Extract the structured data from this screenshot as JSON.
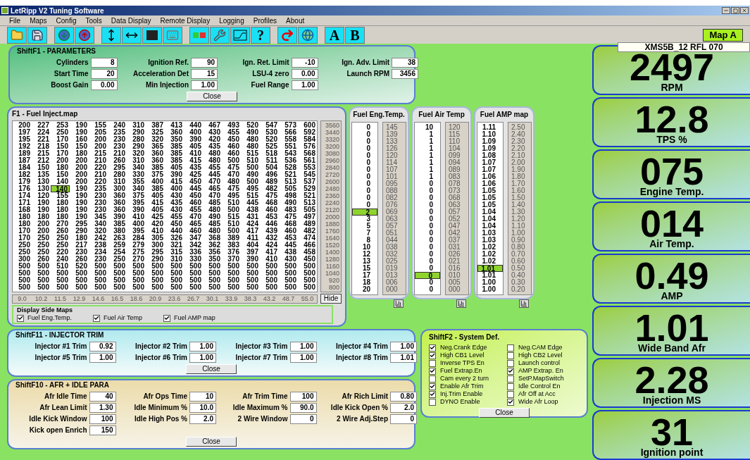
{
  "window": {
    "title": "LetRipp V2 Tuning Software"
  },
  "menu": [
    "File",
    "Maps",
    "Config",
    "Tools",
    "Data Display",
    "Remote Display",
    "Logging",
    "Profiles",
    "About"
  ],
  "toolbar": [
    [
      {
        "kind": "open"
      },
      {
        "kind": "save"
      }
    ],
    [
      {
        "kind": "download"
      },
      {
        "kind": "upload"
      }
    ],
    [
      {
        "kind": "vertical"
      },
      {
        "kind": "horizontal"
      },
      {
        "kind": "block"
      },
      {
        "kind": "key"
      }
    ],
    [
      {
        "kind": "colors"
      },
      {
        "kind": "tools"
      },
      {
        "kind": "graph"
      },
      {
        "kind": "letter",
        "label": "?"
      }
    ],
    [
      {
        "kind": "redo"
      },
      {
        "kind": "globe"
      }
    ],
    [
      {
        "kind": "letter",
        "label": "A"
      },
      {
        "kind": "letter",
        "label": "B"
      }
    ]
  ],
  "map_badge": "Map A",
  "map_name": "XMS5B_12 RFL 070",
  "parameters": {
    "title": "ShiftF1 - PARAMETERS",
    "rows": [
      [
        {
          "label": "Cylinders",
          "value": "8"
        },
        {
          "label": "Ignition Ref.",
          "value": "90"
        },
        {
          "label": "Ign. Ret. Limit",
          "value": "-10"
        },
        {
          "label": "Ign. Adv. Limit",
          "value": "38"
        }
      ],
      [
        {
          "label": "Start Time",
          "value": "20"
        },
        {
          "label": "Acceleration Det",
          "value": "15"
        },
        {
          "label": "LSU-4 zero",
          "value": "0.00"
        },
        {
          "label": "Launch RPM",
          "value": "3456"
        }
      ],
      [
        {
          "label": "Boost Gain",
          "value": "0.00"
        },
        {
          "label": "Min Injection",
          "value": "1.00"
        },
        {
          "label": "Fuel Range",
          "value": "1.00"
        }
      ]
    ],
    "close": "Close"
  },
  "fuel_map": {
    "title": "F1 - Fuel Inject.map",
    "rows": [
      {
        "rpm": "3560",
        "cells": [
          "200",
          "227",
          "253",
          "190",
          "155",
          "240",
          "310",
          "387",
          "413",
          "440",
          "467",
          "493",
          "520",
          "547",
          "573",
          "600"
        ]
      },
      {
        "rpm": "3440",
        "cells": [
          "197",
          "224",
          "250",
          "190",
          "205",
          "235",
          "290",
          "325",
          "360",
          "400",
          "430",
          "455",
          "490",
          "530",
          "566",
          "592"
        ]
      },
      {
        "rpm": "3320",
        "cells": [
          "195",
          "221",
          "170",
          "160",
          "200",
          "230",
          "280",
          "320",
          "350",
          "390",
          "420",
          "450",
          "480",
          "520",
          "558",
          "584"
        ]
      },
      {
        "rpm": "3200",
        "cells": [
          "192",
          "218",
          "150",
          "150",
          "200",
          "230",
          "290",
          "365",
          "385",
          "405",
          "435",
          "460",
          "480",
          "525",
          "551",
          "576"
        ]
      },
      {
        "rpm": "3080",
        "cells": [
          "189",
          "215",
          "170",
          "180",
          "215",
          "210",
          "320",
          "360",
          "385",
          "410",
          "480",
          "460",
          "515",
          "518",
          "543",
          "568"
        ]
      },
      {
        "rpm": "2960",
        "cells": [
          "187",
          "212",
          "200",
          "200",
          "210",
          "260",
          "310",
          "360",
          "385",
          "415",
          "480",
          "500",
          "510",
          "511",
          "536",
          "561"
        ]
      },
      {
        "rpm": "2840",
        "cells": [
          "184",
          "150",
          "180",
          "200",
          "220",
          "295",
          "340",
          "385",
          "405",
          "435",
          "455",
          "475",
          "500",
          "504",
          "528",
          "553"
        ]
      },
      {
        "rpm": "2720",
        "cells": [
          "182",
          "135",
          "150",
          "200",
          "210",
          "280",
          "330",
          "375",
          "390",
          "425",
          "445",
          "470",
          "490",
          "496",
          "521",
          "545"
        ]
      },
      {
        "rpm": "2600",
        "cells": [
          "179",
          "130",
          "140",
          "200",
          "220",
          "310",
          "355",
          "400",
          "415",
          "450",
          "470",
          "480",
          "500",
          "489",
          "513",
          "537"
        ]
      },
      {
        "rpm": "2480",
        "cells": [
          "176",
          "130",
          "140",
          "190",
          "235",
          "300",
          "340",
          "385",
          "400",
          "445",
          "465",
          "475",
          "495",
          "482",
          "505",
          "529"
        ],
        "selected": [
          false,
          false,
          true,
          false,
          false,
          false,
          false,
          false,
          false,
          false,
          false,
          false,
          false,
          false,
          false,
          false
        ]
      },
      {
        "rpm": "2360",
        "cells": [
          "174",
          "120",
          "155",
          "190",
          "230",
          "360",
          "375",
          "405",
          "430",
          "450",
          "470",
          "495",
          "515",
          "475",
          "498",
          "521"
        ]
      },
      {
        "rpm": "2240",
        "cells": [
          "171",
          "190",
          "180",
          "190",
          "230",
          "360",
          "395",
          "415",
          "435",
          "460",
          "485",
          "510",
          "445",
          "468",
          "490",
          "513"
        ]
      },
      {
        "rpm": "2120",
        "cells": [
          "168",
          "190",
          "180",
          "190",
          "230",
          "360",
          "390",
          "405",
          "430",
          "455",
          "480",
          "500",
          "438",
          "460",
          "483",
          "505"
        ]
      },
      {
        "rpm": "2000",
        "cells": [
          "180",
          "180",
          "180",
          "190",
          "345",
          "390",
          "410",
          "425",
          "455",
          "470",
          "490",
          "515",
          "431",
          "453",
          "475",
          "497"
        ]
      },
      {
        "rpm": "1880",
        "cells": [
          "180",
          "200",
          "270",
          "295",
          "340",
          "385",
          "400",
          "420",
          "450",
          "465",
          "485",
          "510",
          "424",
          "446",
          "468",
          "489"
        ]
      },
      {
        "rpm": "1760",
        "cells": [
          "170",
          "200",
          "260",
          "290",
          "320",
          "380",
          "395",
          "410",
          "440",
          "460",
          "480",
          "500",
          "417",
          "439",
          "460",
          "482"
        ]
      },
      {
        "rpm": "1640",
        "cells": [
          "170",
          "250",
          "250",
          "180",
          "242",
          "263",
          "284",
          "305",
          "326",
          "347",
          "368",
          "389",
          "411",
          "432",
          "453",
          "474"
        ]
      },
      {
        "rpm": "1520",
        "cells": [
          "250",
          "250",
          "250",
          "217",
          "238",
          "259",
          "279",
          "300",
          "321",
          "342",
          "362",
          "383",
          "404",
          "424",
          "445",
          "466"
        ]
      },
      {
        "rpm": "1400",
        "cells": [
          "250",
          "250",
          "220",
          "230",
          "234",
          "254",
          "275",
          "295",
          "315",
          "336",
          "356",
          "376",
          "397",
          "417",
          "438",
          "458"
        ]
      },
      {
        "rpm": "1280",
        "cells": [
          "300",
          "260",
          "240",
          "260",
          "230",
          "250",
          "270",
          "290",
          "310",
          "330",
          "350",
          "370",
          "390",
          "410",
          "430",
          "450"
        ]
      },
      {
        "rpm": "1160",
        "cells": [
          "500",
          "500",
          "510",
          "520",
          "500",
          "500",
          "500",
          "500",
          "500",
          "500",
          "500",
          "500",
          "500",
          "500",
          "500",
          "500"
        ]
      },
      {
        "rpm": "1040",
        "cells": [
          "500",
          "500",
          "500",
          "500",
          "500",
          "500",
          "500",
          "500",
          "500",
          "500",
          "500",
          "500",
          "500",
          "500",
          "500",
          "500"
        ]
      },
      {
        "rpm": "920",
        "cells": [
          "500",
          "500",
          "500",
          "500",
          "500",
          "500",
          "500",
          "500",
          "500",
          "500",
          "500",
          "500",
          "500",
          "500",
          "500",
          "500"
        ]
      },
      {
        "rpm": "800",
        "cells": [
          "500",
          "500",
          "500",
          "500",
          "500",
          "500",
          "500",
          "500",
          "500",
          "500",
          "500",
          "500",
          "500",
          "500",
          "500",
          "500"
        ]
      }
    ],
    "axis": [
      "9.0",
      "10.2",
      "11.5",
      "12.9",
      "14.6",
      "16.5",
      "18.6",
      "20.9",
      "23.6",
      "26.7",
      "30.1",
      "33.9",
      "38.3",
      "43.2",
      "48.7",
      "55.0"
    ],
    "hide": "Hide",
    "side_maps_group": {
      "title": "Display Side Maps",
      "options": [
        {
          "label": "Fuel Eng.Temp.",
          "checked": true
        },
        {
          "label": "Fuel Air Temp",
          "checked": true
        },
        {
          "label": "Fuel AMP map",
          "checked": true
        }
      ]
    }
  },
  "side_maps": [
    {
      "title": "Fuel Eng.Temp.",
      "values": [
        "0",
        "0",
        "0",
        "0",
        "0",
        "0",
        "0",
        "0",
        "0",
        "0",
        "0",
        "0",
        "2",
        "3",
        "5",
        "7",
        "8",
        "10",
        "12",
        "13",
        "15",
        "17",
        "18",
        "20"
      ],
      "keys": [
        "145",
        "139",
        "133",
        "126",
        "120",
        "114",
        "107",
        "101",
        "095",
        "088",
        "082",
        "076",
        "069",
        "063",
        "057",
        "051",
        "044",
        "038",
        "032",
        "025",
        "019",
        "013",
        "006",
        "000"
      ],
      "selected": [
        false,
        false,
        false,
        false,
        false,
        false,
        false,
        false,
        false,
        false,
        false,
        false,
        true,
        false,
        false,
        false,
        false,
        false,
        false,
        false,
        false,
        false,
        false,
        false
      ]
    },
    {
      "title": "Fuel Air Temp",
      "values": [
        "10",
        "1",
        "1",
        "1",
        "1",
        "1",
        "1",
        "1",
        "0",
        "0",
        "0",
        "0",
        "0",
        "0",
        "0",
        "0",
        "0",
        "0",
        "0",
        "0",
        "0",
        "0",
        "0",
        "0"
      ],
      "keys": [
        "120",
        "115",
        "110",
        "104",
        "099",
        "094",
        "089",
        "083",
        "078",
        "073",
        "068",
        "063",
        "057",
        "052",
        "047",
        "042",
        "037",
        "031",
        "026",
        "021",
        "016",
        "010",
        "005",
        "000"
      ],
      "selected": [
        false,
        false,
        false,
        false,
        false,
        false,
        false,
        false,
        false,
        false,
        false,
        false,
        false,
        false,
        false,
        false,
        false,
        false,
        false,
        false,
        false,
        true,
        false,
        false
      ]
    },
    {
      "title": "Fuel AMP map",
      "values": [
        "1.11",
        "1.10",
        "1.09",
        "1.09",
        "1.08",
        "1.07",
        "1.07",
        "1.06",
        "1.06",
        "1.05",
        "1.05",
        "1.05",
        "1.04",
        "1.04",
        "1.04",
        "1.03",
        "1.03",
        "1.02",
        "1.02",
        "1.02",
        "1.01",
        "1.01",
        "1.00",
        "1.00"
      ],
      "keys": [
        "2.50",
        "2.40",
        "2.30",
        "2.20",
        "2.10",
        "2.00",
        "1.90",
        "1.80",
        "1.70",
        "1.60",
        "1.50",
        "1.40",
        "1.30",
        "1.20",
        "1.10",
        "1.00",
        "0.90",
        "0.80",
        "0.70",
        "0.60",
        "0.50",
        "0.40",
        "0.30",
        "0.20"
      ],
      "selected": [
        false,
        false,
        false,
        false,
        false,
        false,
        false,
        false,
        false,
        false,
        false,
        false,
        false,
        false,
        false,
        false,
        false,
        false,
        false,
        false,
        true,
        false,
        false,
        false
      ]
    }
  ],
  "injector_trim": {
    "title": "ShiftF11 - INJECTOR TRIM",
    "rows": [
      [
        {
          "label": "Injector #1 Trim",
          "value": "0.92"
        },
        {
          "label": "Injector #2 Trim",
          "value": "1.00"
        },
        {
          "label": "Injector #3 Trim",
          "value": "1.00"
        },
        {
          "label": "Injector #4 Trim",
          "value": "1.00"
        }
      ],
      [
        {
          "label": "Injector #5 Trim",
          "value": "1.00"
        },
        {
          "label": "Injector #6 Trim",
          "value": "1.00"
        },
        {
          "label": "Injector #7 Trim",
          "value": "1.00"
        },
        {
          "label": "Injector #8 Trim",
          "value": "1.01"
        }
      ]
    ],
    "close": "Close"
  },
  "afr_idle": {
    "title": "ShiftF10 - AFR + IDLE PARA",
    "rows": [
      [
        {
          "label": "Afr Idle Time",
          "value": "40"
        },
        {
          "label": "Afr Ops Time",
          "value": "10"
        },
        {
          "label": "Afr Trim Time",
          "value": "100"
        },
        {
          "label": "Afr Rich Limit",
          "value": "0.80"
        }
      ],
      [
        {
          "label": "Afr Lean Limit",
          "value": "1.30"
        },
        {
          "label": "Idle Minimum %",
          "value": "10.0"
        },
        {
          "label": "Idle Maximum %",
          "value": "90.0"
        },
        {
          "label": "Idle Kick Open %",
          "value": "2.0"
        }
      ],
      [
        {
          "label": "Idle Kick Window",
          "value": "100"
        },
        {
          "label": "Idle High Pos %",
          "value": "2.0"
        },
        {
          "label": "2 Wire Window",
          "value": "0"
        },
        {
          "label": "2 Wire Adj.Step",
          "value": "0"
        }
      ],
      [
        {
          "label": "Kick open Enrich",
          "value": "150"
        }
      ]
    ],
    "close": "Close"
  },
  "system_def": {
    "title": "ShiftF2 - System Def.",
    "columns": [
      [
        {
          "label": "Neg.Crank Edge",
          "checked": true
        },
        {
          "label": "High CB1 Level",
          "checked": true
        },
        {
          "label": "Inverse TPS En",
          "checked": false
        },
        {
          "label": "Fuel Extrap.En",
          "checked": true
        },
        {
          "label": "Cam every 2 turn",
          "checked": false
        },
        {
          "label": "Enable Afr Trim",
          "checked": true
        },
        {
          "label": "Inj.Trim Enable",
          "checked": true
        },
        {
          "label": "DYNO Enable",
          "checked": false
        }
      ],
      [
        {
          "label": "Neg.CAM Edge",
          "checked": false
        },
        {
          "label": "High CB2 Level",
          "checked": false
        },
        {
          "label": "Launch control",
          "checked": false
        },
        {
          "label": "AMP Extrap. En",
          "checked": true
        },
        {
          "label": "SetP.MapSwitch",
          "checked": false
        },
        {
          "label": "Idle Control En",
          "checked": false
        },
        {
          "label": "Afr Off at Acc",
          "checked": false
        },
        {
          "label": "Wide Afr Loop",
          "checked": true
        }
      ]
    ],
    "close": "Close"
  },
  "gauges": [
    {
      "value": "2497",
      "label": "RPM"
    },
    {
      "value": "12.8",
      "label": "TPS %"
    },
    {
      "value": "075",
      "label": "Engine Temp."
    },
    {
      "value": "014",
      "label": "Air Temp."
    },
    {
      "value": "0.49",
      "label": "AMP"
    },
    {
      "value": "1.01",
      "label": "Wide Band Afr"
    },
    {
      "value": "2.28",
      "label": "Injection MS"
    },
    {
      "value": "31",
      "label": "Ignition point"
    }
  ]
}
